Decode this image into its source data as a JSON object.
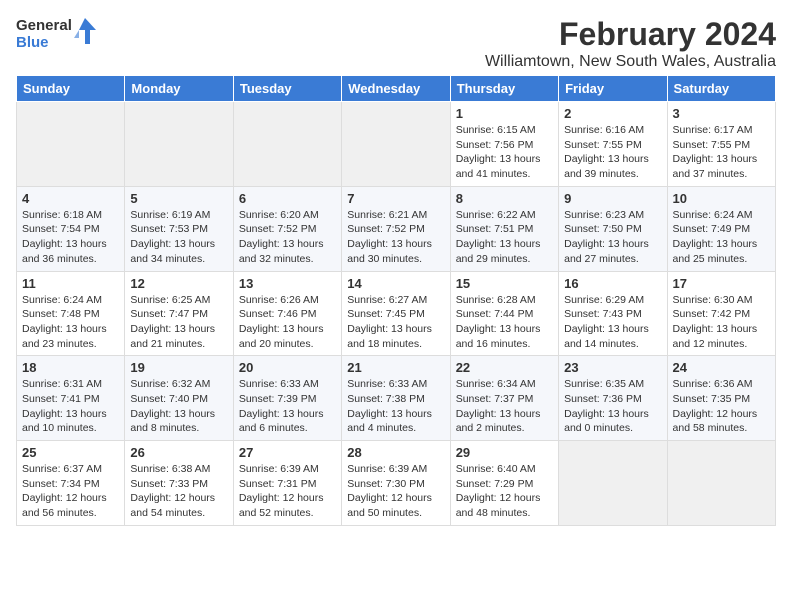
{
  "logo": {
    "line1": "General",
    "line2": "Blue"
  },
  "title": "February 2024",
  "location": "Williamtown, New South Wales, Australia",
  "days_of_week": [
    "Sunday",
    "Monday",
    "Tuesday",
    "Wednesday",
    "Thursday",
    "Friday",
    "Saturday"
  ],
  "weeks": [
    [
      {
        "day": "",
        "info": ""
      },
      {
        "day": "",
        "info": ""
      },
      {
        "day": "",
        "info": ""
      },
      {
        "day": "",
        "info": ""
      },
      {
        "day": "1",
        "info": "Sunrise: 6:15 AM\nSunset: 7:56 PM\nDaylight: 13 hours\nand 41 minutes."
      },
      {
        "day": "2",
        "info": "Sunrise: 6:16 AM\nSunset: 7:55 PM\nDaylight: 13 hours\nand 39 minutes."
      },
      {
        "day": "3",
        "info": "Sunrise: 6:17 AM\nSunset: 7:55 PM\nDaylight: 13 hours\nand 37 minutes."
      }
    ],
    [
      {
        "day": "4",
        "info": "Sunrise: 6:18 AM\nSunset: 7:54 PM\nDaylight: 13 hours\nand 36 minutes."
      },
      {
        "day": "5",
        "info": "Sunrise: 6:19 AM\nSunset: 7:53 PM\nDaylight: 13 hours\nand 34 minutes."
      },
      {
        "day": "6",
        "info": "Sunrise: 6:20 AM\nSunset: 7:52 PM\nDaylight: 13 hours\nand 32 minutes."
      },
      {
        "day": "7",
        "info": "Sunrise: 6:21 AM\nSunset: 7:52 PM\nDaylight: 13 hours\nand 30 minutes."
      },
      {
        "day": "8",
        "info": "Sunrise: 6:22 AM\nSunset: 7:51 PM\nDaylight: 13 hours\nand 29 minutes."
      },
      {
        "day": "9",
        "info": "Sunrise: 6:23 AM\nSunset: 7:50 PM\nDaylight: 13 hours\nand 27 minutes."
      },
      {
        "day": "10",
        "info": "Sunrise: 6:24 AM\nSunset: 7:49 PM\nDaylight: 13 hours\nand 25 minutes."
      }
    ],
    [
      {
        "day": "11",
        "info": "Sunrise: 6:24 AM\nSunset: 7:48 PM\nDaylight: 13 hours\nand 23 minutes."
      },
      {
        "day": "12",
        "info": "Sunrise: 6:25 AM\nSunset: 7:47 PM\nDaylight: 13 hours\nand 21 minutes."
      },
      {
        "day": "13",
        "info": "Sunrise: 6:26 AM\nSunset: 7:46 PM\nDaylight: 13 hours\nand 20 minutes."
      },
      {
        "day": "14",
        "info": "Sunrise: 6:27 AM\nSunset: 7:45 PM\nDaylight: 13 hours\nand 18 minutes."
      },
      {
        "day": "15",
        "info": "Sunrise: 6:28 AM\nSunset: 7:44 PM\nDaylight: 13 hours\nand 16 minutes."
      },
      {
        "day": "16",
        "info": "Sunrise: 6:29 AM\nSunset: 7:43 PM\nDaylight: 13 hours\nand 14 minutes."
      },
      {
        "day": "17",
        "info": "Sunrise: 6:30 AM\nSunset: 7:42 PM\nDaylight: 13 hours\nand 12 minutes."
      }
    ],
    [
      {
        "day": "18",
        "info": "Sunrise: 6:31 AM\nSunset: 7:41 PM\nDaylight: 13 hours\nand 10 minutes."
      },
      {
        "day": "19",
        "info": "Sunrise: 6:32 AM\nSunset: 7:40 PM\nDaylight: 13 hours\nand 8 minutes."
      },
      {
        "day": "20",
        "info": "Sunrise: 6:33 AM\nSunset: 7:39 PM\nDaylight: 13 hours\nand 6 minutes."
      },
      {
        "day": "21",
        "info": "Sunrise: 6:33 AM\nSunset: 7:38 PM\nDaylight: 13 hours\nand 4 minutes."
      },
      {
        "day": "22",
        "info": "Sunrise: 6:34 AM\nSunset: 7:37 PM\nDaylight: 13 hours\nand 2 minutes."
      },
      {
        "day": "23",
        "info": "Sunrise: 6:35 AM\nSunset: 7:36 PM\nDaylight: 13 hours\nand 0 minutes."
      },
      {
        "day": "24",
        "info": "Sunrise: 6:36 AM\nSunset: 7:35 PM\nDaylight: 12 hours\nand 58 minutes."
      }
    ],
    [
      {
        "day": "25",
        "info": "Sunrise: 6:37 AM\nSunset: 7:34 PM\nDaylight: 12 hours\nand 56 minutes."
      },
      {
        "day": "26",
        "info": "Sunrise: 6:38 AM\nSunset: 7:33 PM\nDaylight: 12 hours\nand 54 minutes."
      },
      {
        "day": "27",
        "info": "Sunrise: 6:39 AM\nSunset: 7:31 PM\nDaylight: 12 hours\nand 52 minutes."
      },
      {
        "day": "28",
        "info": "Sunrise: 6:39 AM\nSunset: 7:30 PM\nDaylight: 12 hours\nand 50 minutes."
      },
      {
        "day": "29",
        "info": "Sunrise: 6:40 AM\nSunset: 7:29 PM\nDaylight: 12 hours\nand 48 minutes."
      },
      {
        "day": "",
        "info": ""
      },
      {
        "day": "",
        "info": ""
      }
    ]
  ]
}
